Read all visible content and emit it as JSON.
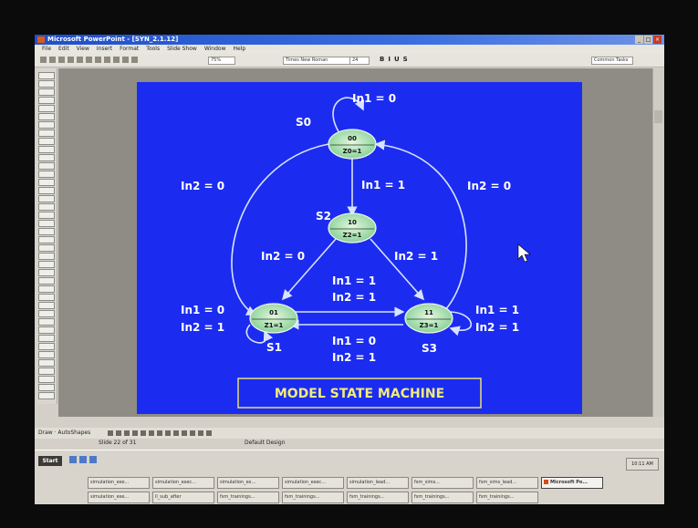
{
  "window": {
    "title": "Microsoft PowerPoint - [SYN_2.1.12]",
    "controls": [
      "_",
      "□",
      "×"
    ]
  },
  "menubar": [
    "File",
    "Edit",
    "View",
    "Insert",
    "Format",
    "Tools",
    "Slide Show",
    "Window",
    "Help"
  ],
  "toolbar": {
    "zoom": "75%",
    "font": "Times New Roman",
    "size": "24",
    "format_buttons": [
      "B",
      "I",
      "U",
      "S"
    ],
    "common_tasks": "Common Tasks"
  },
  "slide": {
    "caption": "MODEL STATE MACHINE",
    "states": [
      {
        "code": "00",
        "output": "Z0=1",
        "name": "S0"
      },
      {
        "code": "10",
        "output": "Z2=1",
        "name": "S2"
      },
      {
        "code": "01",
        "output": "Z1=1",
        "name": "S1"
      },
      {
        "code": "11",
        "output": "Z3=1",
        "name": "S3"
      }
    ],
    "transitions": {
      "s0_self": "In1 = 0",
      "s0_to_s2": "In1 = 1",
      "s0_to_s1": "In2 = 0",
      "s3_to_s0": "In2 = 0",
      "s2_to_s1": "In2 = 0",
      "s2_to_s3": "In2 = 1",
      "s1_to_s3_a": "In1 = 1",
      "s1_to_s3_b": "In2 = 1",
      "s3_to_s1_a": "In1 = 0",
      "s3_to_s1_b": "In2 = 1",
      "s1_self_a": "In1 = 0",
      "s1_self_b": "In2 = 1",
      "s3_self_a": "In1 = 1",
      "s3_self_b": "In2 = 1"
    }
  },
  "drawbar": {
    "draw": "Draw",
    "autoshapes": "AutoShapes"
  },
  "statusbar": {
    "slide": "Slide 22 of 31",
    "design": "Default Design"
  },
  "taskbar": {
    "start": "Start",
    "clock": "10:11 AM",
    "tasks": [
      "simulation_exe...",
      "simulation_exec...",
      "simulation_ex...",
      "simulation_exec...",
      "simulation_lead...",
      "fsm_sims...",
      "fsm_sims_lead...",
      "Microsoft Po...",
      "simulation_exe...",
      "ll_sub_after",
      "fsm_trainings...",
      "fsm_trainings...",
      "fsm_trainings...",
      "fsm_trainings...",
      "fsm_trainings..."
    ]
  }
}
